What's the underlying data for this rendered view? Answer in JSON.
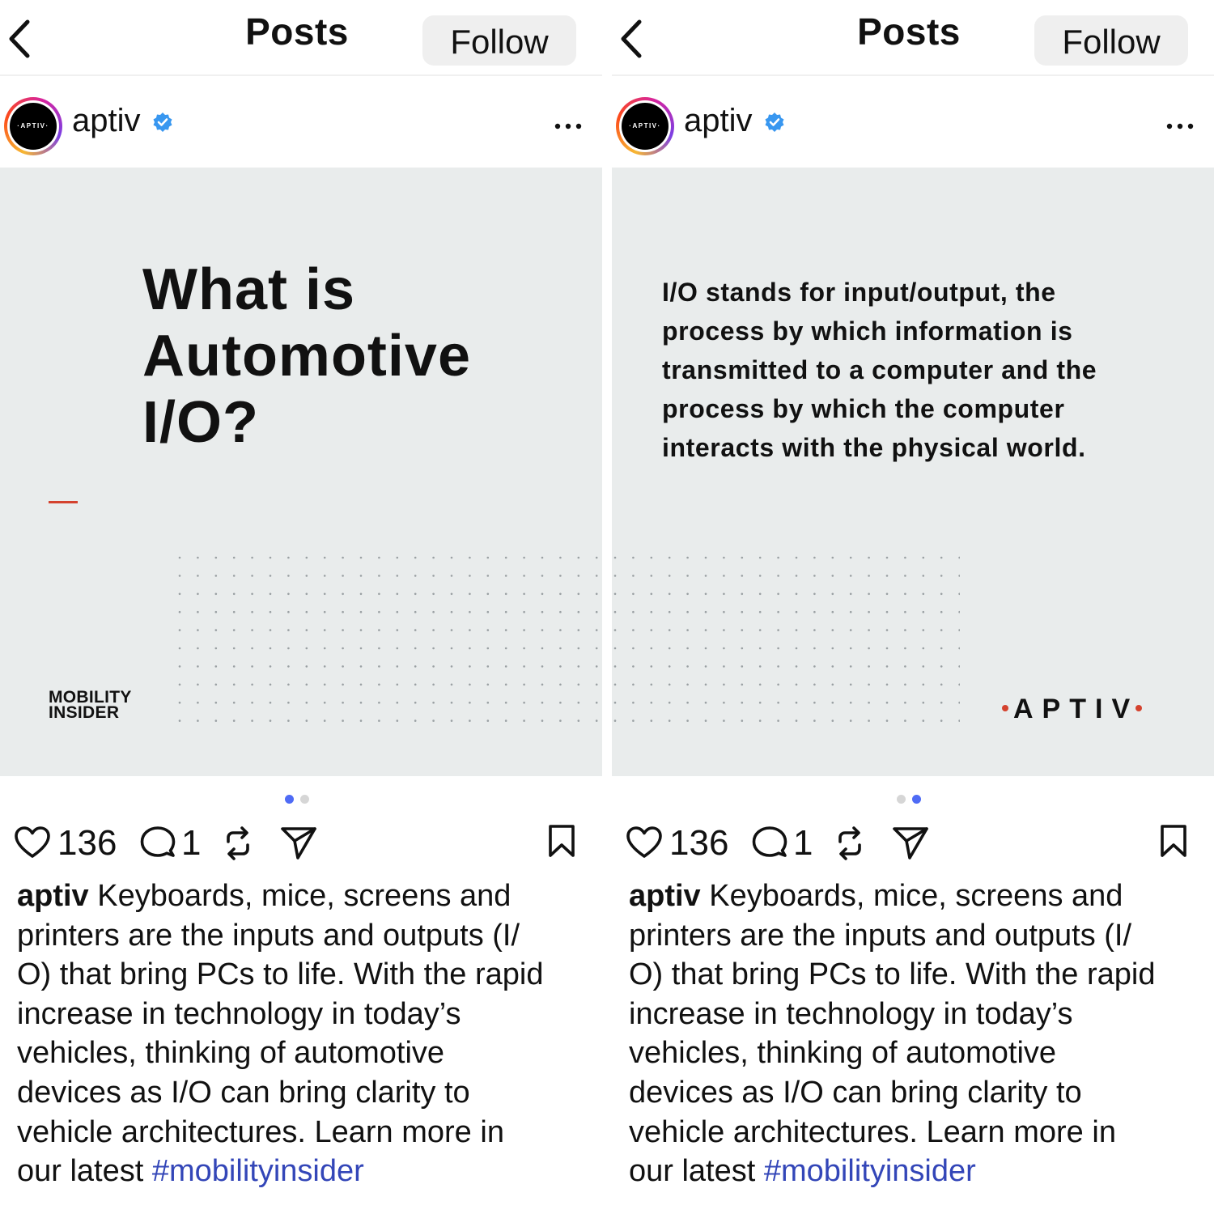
{
  "screens": [
    {
      "header": {
        "title": "Posts",
        "follow_label": "Follow"
      },
      "account": {
        "name": "aptiv",
        "avatar_text": "·APTIV·"
      },
      "slide": {
        "title_lines": [
          "What is",
          "Automotive",
          "I/O?"
        ],
        "brand_lines": [
          "MOBILITY",
          "INSIDER"
        ]
      },
      "carousel": {
        "count": 2,
        "active_index": 0
      },
      "actions": {
        "likes": "136",
        "comments": "1"
      },
      "caption": {
        "username": "aptiv",
        "lines": [
          "Keyboards, mice, screens and",
          "printers are the inputs and outputs (I/",
          "O) that bring PCs to life. With the rapid",
          "increase in technology in today’s",
          "vehicles, thinking of automotive",
          "devices as I/O can bring clarity to",
          "vehicle architectures. Learn more in",
          "our latest "
        ],
        "hashtag": "#mobilityinsider"
      }
    },
    {
      "header": {
        "title": "Posts",
        "follow_label": "Follow"
      },
      "account": {
        "name": "aptiv",
        "avatar_text": "·APTIV·"
      },
      "slide": {
        "body_lines": [
          "I/O stands for input/output, the",
          "process by which information is",
          "transmitted to a computer and the",
          "process by which the computer",
          "interacts with the physical world."
        ],
        "brand_wordmark": "APTIV"
      },
      "carousel": {
        "count": 2,
        "active_index": 1
      },
      "actions": {
        "likes": "136",
        "comments": "1"
      },
      "caption": {
        "username": "aptiv",
        "lines": [
          "Keyboards, mice, screens and",
          "printers are the inputs and outputs (I/",
          "O) that bring PCs to life. With the rapid",
          "increase in technology in today’s",
          "vehicles, thinking of automotive",
          "devices as I/O can bring clarity to",
          "vehicle architectures. Learn more in",
          "our latest "
        ],
        "hashtag": "#mobilityinsider"
      }
    }
  ],
  "colors": {
    "accent_blue": "#3346b8",
    "carousel_active": "#4f6bf5",
    "verified_blue": "#3897f0",
    "brand_red": "#d4422e",
    "slide_background": "#e9ecec",
    "follow_button": "#efefef"
  },
  "icons": {
    "back": "chevron-left-icon",
    "verified": "verified-badge-icon",
    "more": "more-horizontal-icon",
    "like": "heart-icon",
    "comment": "comment-bubble-icon",
    "repost": "repost-icon",
    "share": "send-icon",
    "save": "bookmark-icon"
  }
}
